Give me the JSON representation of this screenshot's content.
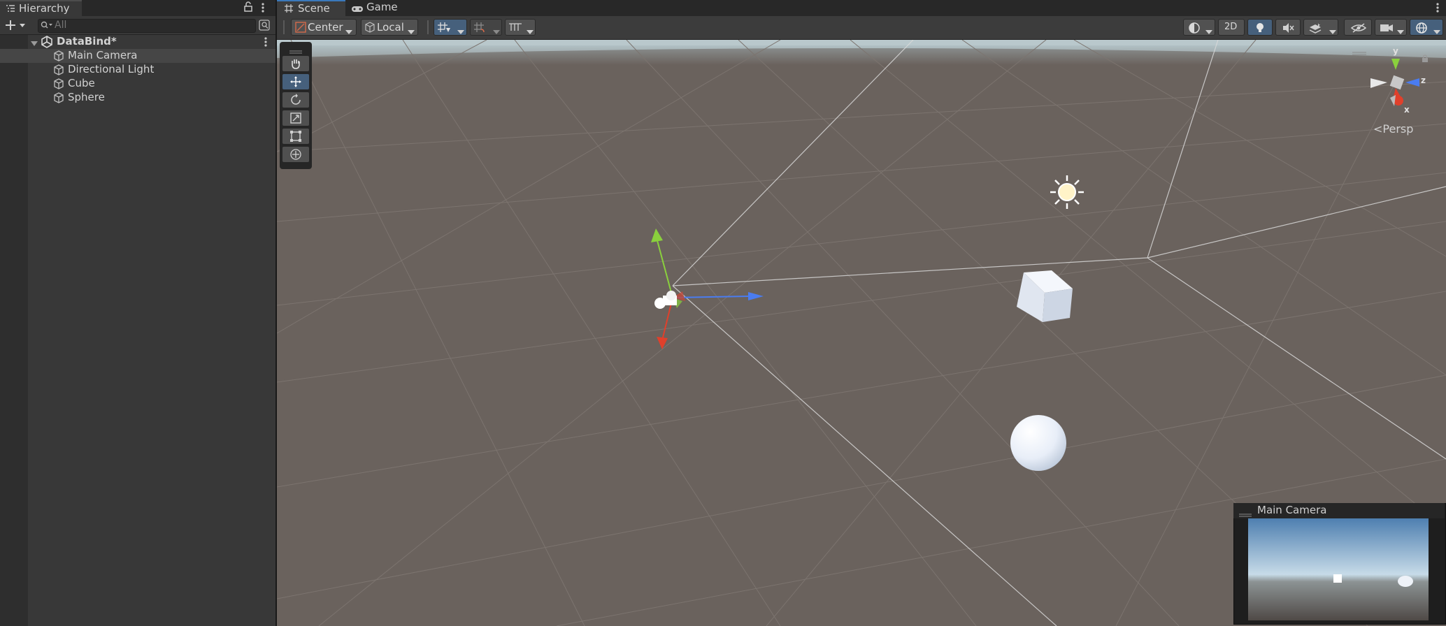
{
  "hierarchy": {
    "tab_label": "Hierarchy",
    "search_placeholder": "All",
    "scene_name": "DataBind*",
    "items": [
      {
        "label": "Main Camera"
      },
      {
        "label": "Directional Light"
      },
      {
        "label": "Cube"
      },
      {
        "label": "Sphere"
      }
    ]
  },
  "scene": {
    "tabs": [
      {
        "label": "Scene"
      },
      {
        "label": "Game"
      }
    ],
    "toolbar": {
      "pivot_label": "Center",
      "space_label": "Local",
      "mode_2d_label": "2D"
    },
    "view_label": "Persp",
    "gizmo_axes": {
      "y": "y",
      "z": "z",
      "x": "x"
    },
    "camera_preview_title": "Main Camera"
  },
  "colors": {
    "accent": "#3a79bb",
    "ground": "#6a625d",
    "x_axis": "#e0402b",
    "y_axis": "#8ad03d",
    "z_axis": "#4a7cf0"
  }
}
